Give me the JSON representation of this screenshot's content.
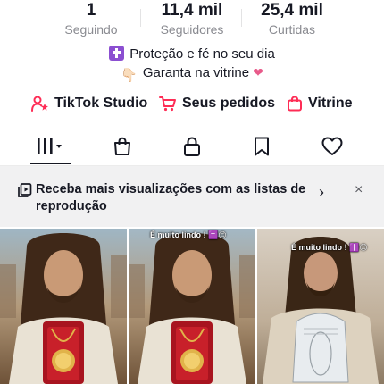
{
  "stats": [
    {
      "value": "1",
      "label": "Seguindo"
    },
    {
      "value": "11,4 mil",
      "label": "Seguidores"
    },
    {
      "value": "25,4 mil",
      "label": "Curtidas"
    }
  ],
  "bio": {
    "line1": "Proteção e fé no seu dia",
    "line2": "Garanta na vitrine"
  },
  "links": {
    "studio": "TikTok Studio",
    "orders": "Seus pedidos",
    "showcase": "Vitrine"
  },
  "tabs": [
    {
      "icon": "grid-icon",
      "active": true
    },
    {
      "icon": "bag-icon",
      "active": false
    },
    {
      "icon": "lock-icon",
      "active": false
    },
    {
      "icon": "bookmark-icon",
      "active": false
    },
    {
      "icon": "heart-icon",
      "active": false
    }
  ],
  "banner": {
    "text": "Receba mais visualizações com as listas de reprodução",
    "chevron": "›",
    "close": "×"
  },
  "videos": [
    {
      "caption": ""
    },
    {
      "caption": "É muito lindo ! ✝️😊"
    },
    {
      "caption": "É muito lindo ! ✝️😊"
    }
  ],
  "colors": {
    "accent": "#fe2c55",
    "text": "#161823",
    "muted": "#8a8b91",
    "banner_bg": "#f1f1f2"
  }
}
